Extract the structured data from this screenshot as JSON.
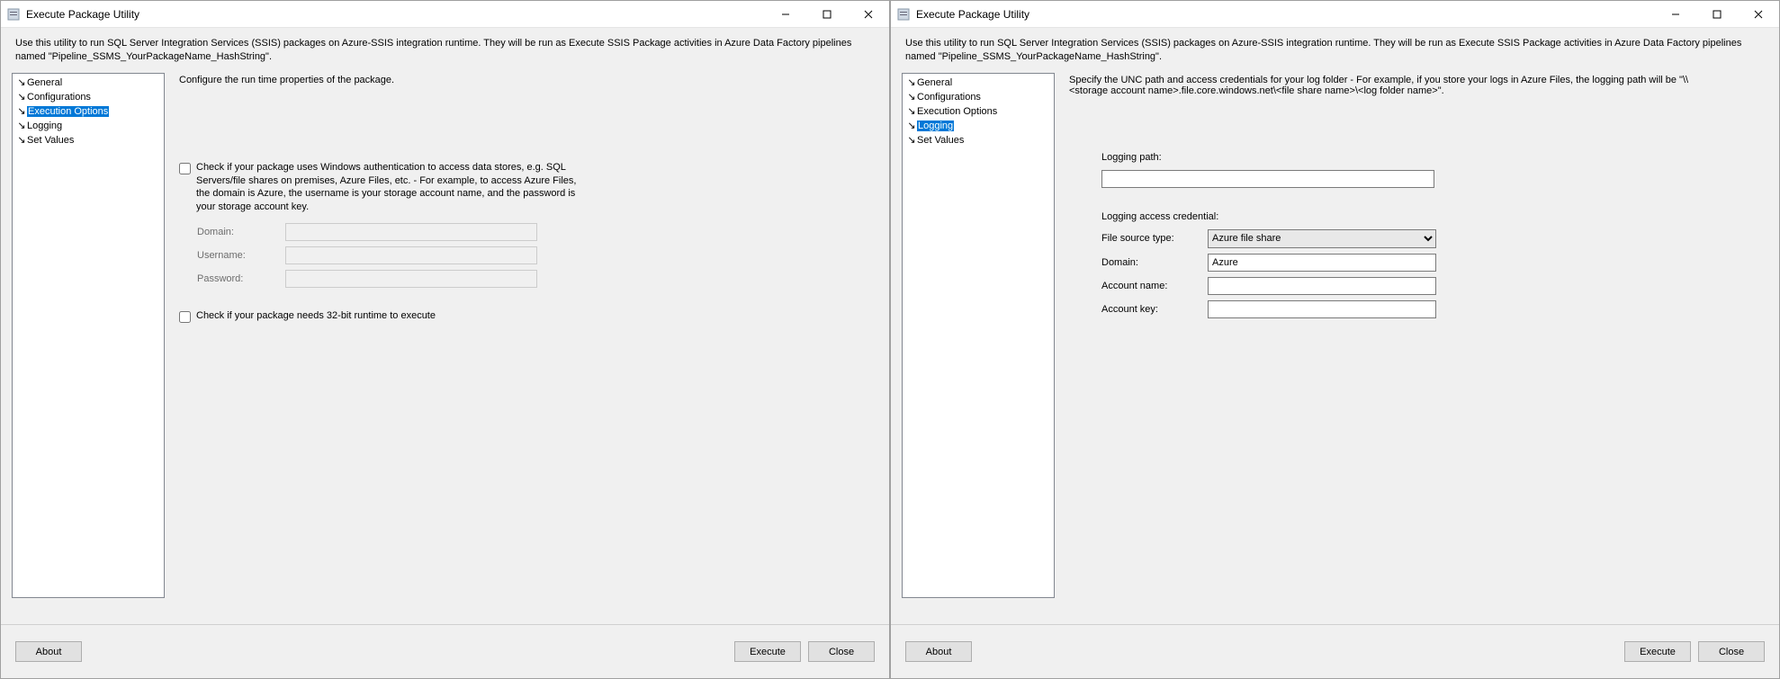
{
  "app_title": "Execute Package Utility",
  "description": "Use this utility to run SQL Server Integration Services (SSIS) packages on Azure-SSIS integration runtime. They will be run as Execute SSIS Package activities in Azure Data Factory pipelines named \"Pipeline_SSMS_YourPackageName_HashString\".",
  "nav": {
    "items": [
      {
        "label": "General"
      },
      {
        "label": "Configurations"
      },
      {
        "label": "Execution Options"
      },
      {
        "label": "Logging"
      },
      {
        "label": "Set Values"
      }
    ]
  },
  "buttons": {
    "about": "About",
    "execute": "Execute",
    "close": "Close"
  },
  "left": {
    "heading": "Configure the run time properties of the package.",
    "check_auth": "Check if your package uses Windows authentication to access data stores, e.g. SQL Servers/file shares on premises, Azure Files, etc. - For example, to access Azure Files, the domain is Azure, the username is your storage account name, and the password is your storage account key.",
    "labels": {
      "domain": "Domain:",
      "username": "Username:",
      "password": "Password:"
    },
    "check_32bit": "Check if your package needs 32-bit runtime to execute"
  },
  "right": {
    "heading": "Specify the UNC path and access credentials for your log folder - For example, if you store your logs in Azure Files, the logging path will be \"\\\\<storage account name>.file.core.windows.net\\<file share name>\\<log folder name>\".",
    "logging_path_label": "Logging path:",
    "logging_path_value": "",
    "cred_label": "Logging access credential:",
    "labels": {
      "file_source": "File source type:",
      "domain": "Domain:",
      "account_name": "Account name:",
      "account_key": "Account key:"
    },
    "file_source_value": "Azure file share",
    "domain_value": "Azure",
    "account_name_value": "",
    "account_key_value": ""
  }
}
